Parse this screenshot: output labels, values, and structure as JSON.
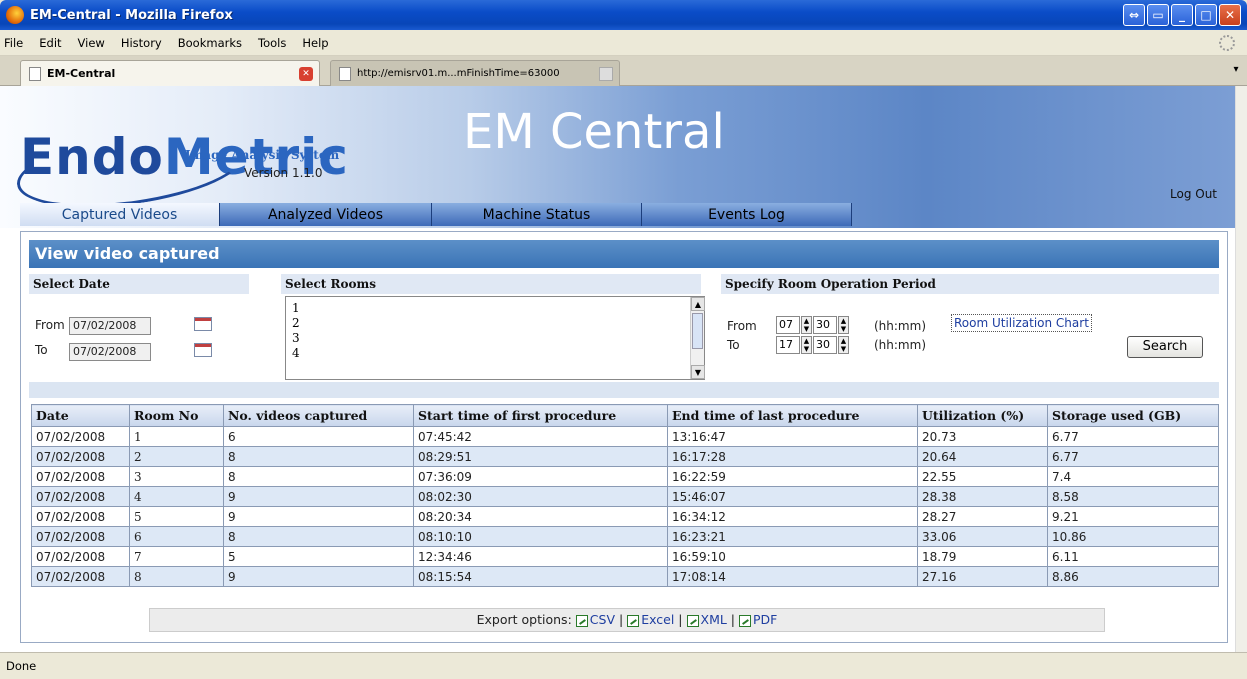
{
  "window": {
    "title": "EM-Central - Mozilla Firefox"
  },
  "menu": [
    "File",
    "Edit",
    "View",
    "History",
    "Bookmarks",
    "Tools",
    "Help"
  ],
  "tabs": [
    {
      "label": "EM-Central"
    },
    {
      "label": "http://emisrv01.m...mFinishTime=63000"
    }
  ],
  "logo": {
    "endo": "Endo",
    "metric": "Metric",
    "subtitle": "Image Analysis System",
    "version": "Version 1.1.0"
  },
  "app_title": "EM Central",
  "logout": "Log Out",
  "nav": [
    "Captured Videos",
    "Analyzed Videos",
    "Machine Status",
    "Events Log"
  ],
  "panel": {
    "title": "View video captured",
    "select_date": "Select Date",
    "select_rooms": "Select Rooms",
    "period": "Specify Room Operation Period",
    "from_label": "From",
    "to_label": "To",
    "from_date": "07/02/2008",
    "to_date": "07/02/2008",
    "rooms": [
      "1",
      "2",
      "3",
      "4"
    ],
    "from_hh": "07",
    "from_mm": "30",
    "to_hh": "17",
    "to_mm": "30",
    "hhmm": "(hh:mm)",
    "chart_link": "Room Utilization Chart",
    "search": "Search"
  },
  "table": {
    "headers": [
      "Date",
      "Room No",
      "No. videos captured",
      "Start time of first procedure",
      "End time of last procedure",
      "Utilization (%)",
      "Storage used (GB)"
    ],
    "rows": [
      [
        "07/02/2008",
        "1",
        "6",
        "07:45:42",
        "13:16:47",
        "20.73",
        "6.77"
      ],
      [
        "07/02/2008",
        "2",
        "8",
        "08:29:51",
        "16:17:28",
        "20.64",
        "6.77"
      ],
      [
        "07/02/2008",
        "3",
        "8",
        "07:36:09",
        "16:22:59",
        "22.55",
        "7.4"
      ],
      [
        "07/02/2008",
        "4",
        "9",
        "08:02:30",
        "15:46:07",
        "28.38",
        "8.58"
      ],
      [
        "07/02/2008",
        "5",
        "9",
        "08:20:34",
        "16:34:12",
        "28.27",
        "9.21"
      ],
      [
        "07/02/2008",
        "6",
        "8",
        "08:10:10",
        "16:23:21",
        "33.06",
        "10.86"
      ],
      [
        "07/02/2008",
        "7",
        "5",
        "12:34:46",
        "16:59:10",
        "18.79",
        "6.11"
      ],
      [
        "07/02/2008",
        "8",
        "9",
        "08:15:54",
        "17:08:14",
        "27.16",
        "8.86"
      ]
    ]
  },
  "export": {
    "label": "Export options:",
    "csv": "CSV",
    "excel": "Excel",
    "xml": "XML",
    "pdf": "PDF",
    "sep": "|"
  },
  "status": "Done"
}
